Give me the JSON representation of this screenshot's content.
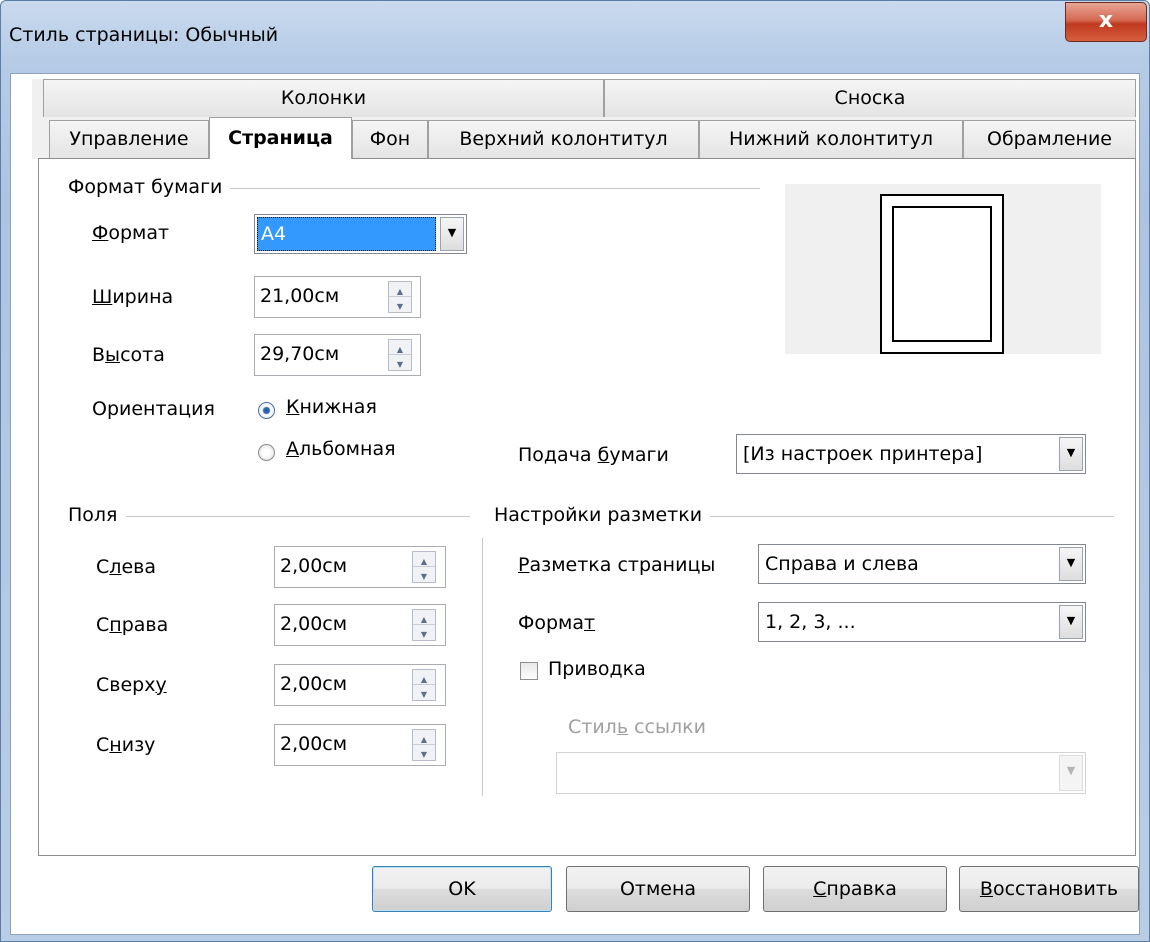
{
  "window": {
    "title": "Стиль страницы: Обычный",
    "close_symbol": "x"
  },
  "tabs_row1": [
    {
      "label": "Колонки"
    },
    {
      "label": "Сноска"
    }
  ],
  "tabs_row2": [
    {
      "label": "Управление"
    },
    {
      "label": "Страница",
      "active": true
    },
    {
      "label": "Фон"
    },
    {
      "label": "Верхний колонтитул"
    },
    {
      "label": "Нижний колонтитул"
    },
    {
      "label": "Обрамление"
    }
  ],
  "paper_format": {
    "group_label": "Формат бумаги",
    "format": {
      "label_accel": "Ф",
      "label_rest": "ормат",
      "value": "A4"
    },
    "width": {
      "label_accel": "Ш",
      "label_rest": "ирина",
      "value": "21,00см"
    },
    "height": {
      "label_pre": "В",
      "label_accel": "ы",
      "label_rest": "сота",
      "value": "29,70см"
    },
    "orientation": {
      "label": "Ориентация",
      "portrait": {
        "accel": "К",
        "rest": "нижная",
        "checked": true
      },
      "landscape": {
        "accel": "А",
        "rest": "льбомная",
        "checked": false
      }
    }
  },
  "paper_tray": {
    "label_pre": "Подача ",
    "label_accel": "б",
    "label_rest": "умаги",
    "value": "[Из настроек принтера]"
  },
  "margins": {
    "group_label": "Поля",
    "left": {
      "label_pre": "С",
      "label_accel": "л",
      "label_rest": "ева",
      "value": "2,00см"
    },
    "right": {
      "label_pre": "С",
      "label_accel": "п",
      "label_rest": "рава",
      "value": "2,00см"
    },
    "top": {
      "label_pre": "Сверх",
      "label_accel": "у",
      "label_rest": "",
      "value": "2,00см"
    },
    "bottom": {
      "label_pre": "С",
      "label_accel": "н",
      "label_rest": "изу",
      "value": "2,00см"
    }
  },
  "layout_settings": {
    "group_label": "Настройки разметки",
    "page_layout": {
      "label_accel": "Р",
      "label_rest": "азметка страницы",
      "value": "Справа и слева"
    },
    "format": {
      "label_pre": "Форма",
      "label_accel": "т",
      "label_rest": "",
      "value": "1, 2, 3, ..."
    },
    "register_true": {
      "label": "Приводка",
      "checked": false
    },
    "ref_style": {
      "label_pre": "Стил",
      "label_accel": "ь",
      "label_rest": " ссылки",
      "value": ""
    }
  },
  "buttons": {
    "ok": "OK",
    "cancel": "Отмена",
    "help": {
      "accel": "С",
      "rest": "правка"
    },
    "reset": {
      "accel": "В",
      "rest": "осстановить"
    }
  },
  "colors": {
    "accent_selection": "#3399ff",
    "close_button": "#c8462b",
    "title_gradient": "#b5cbe6"
  },
  "icons": {
    "dropdown": "chevron-down-icon",
    "spin": "spin-arrows-icon",
    "close": "close-icon"
  }
}
